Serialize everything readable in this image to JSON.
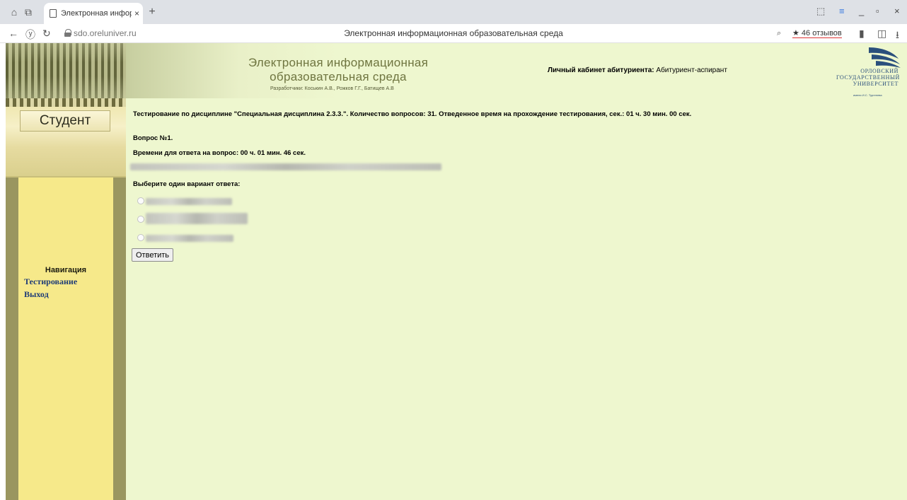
{
  "browser": {
    "tab_title": "Электронная информа",
    "tab_close": "×",
    "new_tab": "+",
    "url": "sdo.oreluniver.ru",
    "page_title": "Электронная информационная образовательная среда",
    "reviews": "★ 46 отзывов"
  },
  "header": {
    "title_line1": "Электронная информационная",
    "title_line2": "образовательная среда",
    "developers": "Разработчики: Коськин А.В., Рожков Г.Г., Батищев А.В",
    "cabinet_label": "Личный кабинет абитуриента:",
    "cabinet_value": "Абитуриент-аспирант",
    "logo_line1": "ОРЛОВСКИЙ",
    "logo_line2": "ГОСУДАРСТВЕННЫЙ",
    "logo_line3": "УНИВЕРСИТЕТ",
    "logo_sub": "имени И.С. Тургенева"
  },
  "sidebar": {
    "role": "Студент",
    "nav_heading": "Навигация",
    "links": [
      "Тестирование",
      "Выход"
    ]
  },
  "test": {
    "header": "Тестирование по дисциплине \"Специальная дисциплина 2.3.3.\". Количество вопросов: 31. Отведенное время на прохождение тестирования, сек.: 01 ч. 30 мин. 00 сек.",
    "question_number": "Вопрос №1.",
    "time_left": "Времени для ответа на вопрос: 00 ч. 01 мин. 46 сек.",
    "choose_prompt": "Выберите один вариант ответа:",
    "answer_button": "Ответить"
  },
  "colors": {
    "page_bg": "#eef7cf",
    "link": "#1f3c77",
    "logo": "#2a4f7c"
  }
}
